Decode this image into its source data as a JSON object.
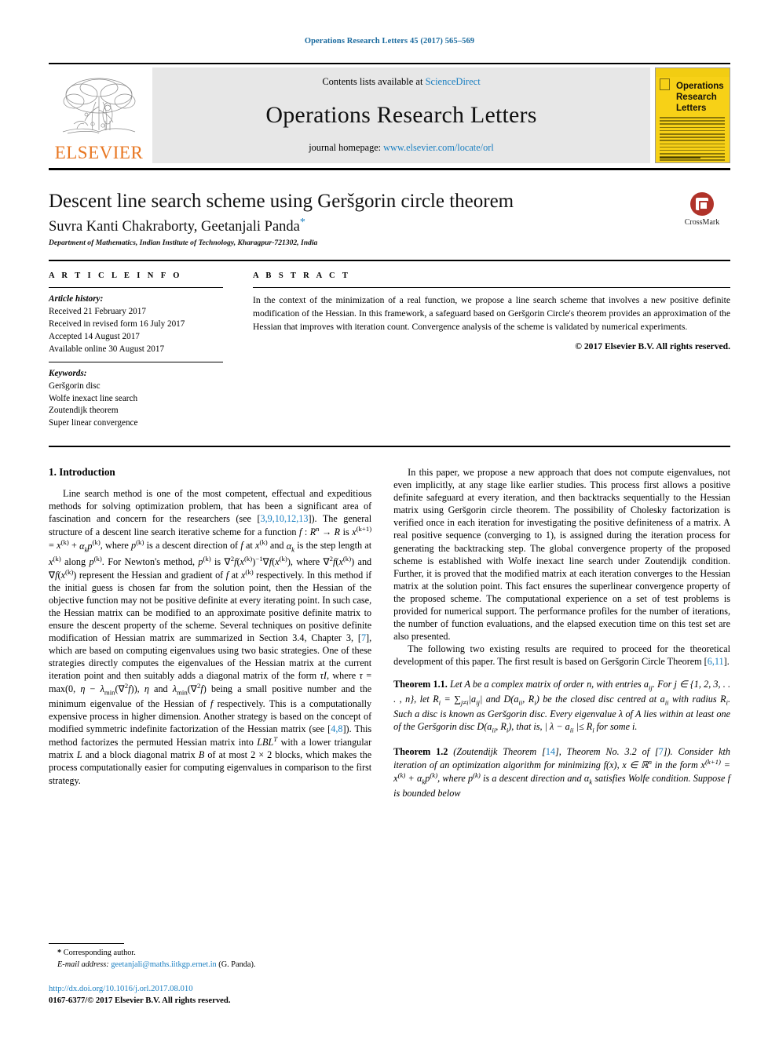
{
  "running_head": "Operations Research Letters 45 (2017) 565–569",
  "masthead": {
    "contents_prefix": "Contents lists available at ",
    "contents_link": "ScienceDirect",
    "journal_name": "Operations Research Letters",
    "homepage_prefix": "journal homepage: ",
    "homepage_link": "www.elsevier.com/locate/orl",
    "publisher": "ELSEVIER",
    "cover_title": "Operations\nResearch\nLetters"
  },
  "title_block": {
    "title": "Descent line search scheme using Geršgorin circle theorem",
    "authors": "Suvra Kanti Chakraborty, Geetanjali Panda",
    "corresponding_marker": "*",
    "affiliation": "Department of Mathematics, Indian Institute of Technology, Kharagpur-721302, India",
    "crossmark_label": "CrossMark"
  },
  "article_info": {
    "heading": "A R T I C L E   I N F O",
    "history_label": "Article history:",
    "history": [
      "Received 21 February 2017",
      "Received in revised form 16 July 2017",
      "Accepted 14 August 2017",
      "Available online 30 August 2017"
    ],
    "keywords_label": "Keywords:",
    "keywords": [
      "Geršgorin disc",
      "Wolfe inexact line search",
      "Zoutendijk theorem",
      "Super linear convergence"
    ]
  },
  "abstract": {
    "heading": "A B S T R A C T",
    "text": "In the context of the minimization of a real function, we propose a line search scheme that involves a new positive definite modification of the Hessian. In this framework, a safeguard based on Geršgorin Circle's theorem provides an approximation of the Hessian that improves with iteration count. Convergence analysis of the scheme is validated by numerical experiments.",
    "copyright": "© 2017 Elsevier B.V. All rights reserved."
  },
  "body": {
    "section1_heading": "1. Introduction",
    "left_para1_a": "Line search method is one of the most competent, effectual and expeditious methods for solving optimization problem, that has been a significant area of fascination and concern for the researchers (see [",
    "left_para1_refs": "3,9,10,12,13",
    "left_para1_b": "]). The general structure of a descent line search iterative scheme for a function ",
    "left_para1_c": "], which are based on computing eigenvalues using two basic strategies. One of these strategies directly computes the eigenvalues of the Hessian matrix at the current iteration point and then suitably adds a diagonal matrix of the form ",
    "ref_7": "7",
    "ref_48": "4,8",
    "right_para1": "In this paper, we propose a new approach that does not compute eigenvalues, not even implicitly, at any stage like earlier studies. This process first allows a positive definite safeguard at every iteration, and then backtracks sequentially to the Hessian matrix using Geršgorin circle theorem. The possibility of Cholesky factorization is verified once in each iteration for investigating the positive definiteness of a matrix. A real positive sequence (converging to 1), is assigned during the iteration process for generating the backtracking step. The global convergence property of the proposed scheme is established with Wolfe inexact line search under Zoutendijk condition. Further, it is proved that the modified matrix at each iteration converges to the Hessian matrix at the solution point. This fact ensures the superlinear convergence property of the proposed scheme. The computational experience on a set of test problems is provided for numerical support. The performance profiles for the number of iterations, the number of function evaluations, and the elapsed execution time on this test set are also presented.",
    "right_para2_a": "The following two existing results are required to proceed for the theoretical development of this paper. The first result is based on Geršgorin Circle Theorem [",
    "right_para2_refs": "6,11",
    "right_para2_b": "].",
    "theorem11_label": "Theorem 1.1.",
    "theorem12_label": "Theorem 1.2",
    "ref_14": "14",
    "ref_7b": "7"
  },
  "footnote": {
    "star": "*",
    "corresponding": "Corresponding author.",
    "email_label": "E-mail address:",
    "email": "geetanjali@maths.iitkgp.ernet.in",
    "email_suffix": "(G. Panda)."
  },
  "footer": {
    "doi": "http://dx.doi.org/10.1016/j.orl.2017.08.010",
    "issn_line": "0167-6377/© 2017 Elsevier B.V. All rights reserved."
  },
  "colors": {
    "link": "#1a7fc1",
    "running_head": "#1a6a9e",
    "elsevier_orange": "#e87722",
    "cover_yellow": "#f7d117",
    "crossmark_red": "#b0332a"
  }
}
